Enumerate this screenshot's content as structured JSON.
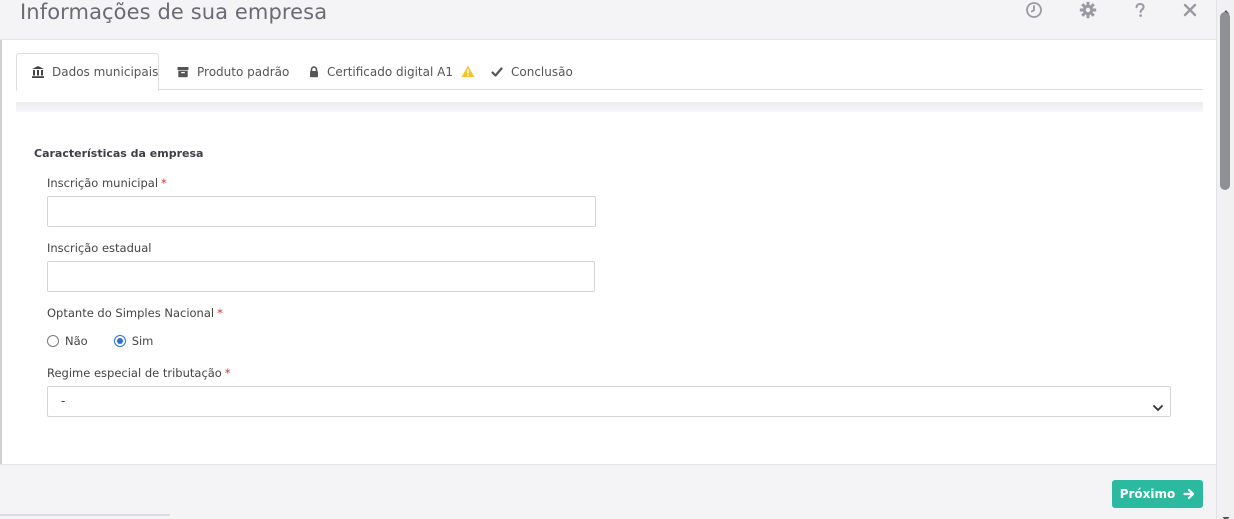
{
  "header": {
    "title": "Informações de sua empresa",
    "icons": [
      "clock-icon",
      "gear-icon",
      "question-icon",
      "close-icon"
    ]
  },
  "tabs": [
    {
      "label": "Dados municipais",
      "icon": "bank-icon",
      "active": true
    },
    {
      "label": "Produto padrão",
      "icon": "box-icon",
      "active": false
    },
    {
      "label": "Certificado digital A1",
      "icon": "lock-icon",
      "badge_icon": "warning-icon",
      "active": false
    },
    {
      "label": "Conclusão",
      "icon": "check-icon",
      "active": false
    }
  ],
  "form": {
    "section_title": "Características da empresa",
    "inscricao_municipal": {
      "label": "Inscrição municipal",
      "required_mark": "*",
      "value": ""
    },
    "inscricao_estadual": {
      "label": "Inscrição estadual",
      "value": ""
    },
    "simples_nacional": {
      "label": "Optante do Simples Nacional",
      "required_mark": "*",
      "options": [
        {
          "label": "Não",
          "checked": false
        },
        {
          "label": "Sim",
          "checked": true
        }
      ]
    },
    "regime_especial": {
      "label": "Regime especial de tributação",
      "required_mark": "*",
      "selected": "-"
    }
  },
  "footer": {
    "next_label": "Próximo"
  },
  "colors": {
    "accent": "#2bb9a0",
    "required": "#d9302f",
    "radio": "#2b6fd6",
    "warning": "#f2c230"
  }
}
